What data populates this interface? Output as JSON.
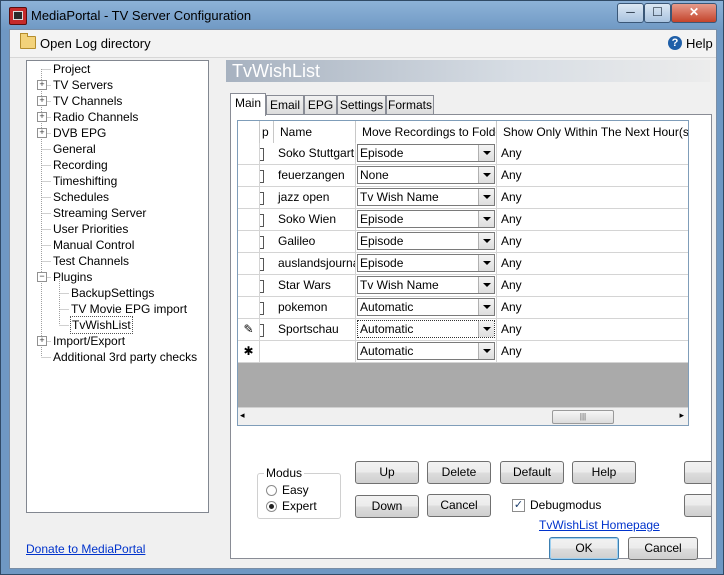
{
  "window": {
    "title": "MediaPortal - TV Server Configuration",
    "min": "─",
    "max": "☐",
    "close": "✕"
  },
  "toolbar": {
    "open_log": "Open Log directory",
    "help": "Help",
    "help_glyph": "?"
  },
  "tree": {
    "items": [
      {
        "label": "Project",
        "level": 0,
        "expand": ""
      },
      {
        "label": "TV Servers",
        "level": 0,
        "expand": "+"
      },
      {
        "label": "TV Channels",
        "level": 0,
        "expand": "+"
      },
      {
        "label": "Radio Channels",
        "level": 0,
        "expand": "+"
      },
      {
        "label": "DVB EPG",
        "level": 0,
        "expand": "+"
      },
      {
        "label": "General",
        "level": 0,
        "expand": ""
      },
      {
        "label": "Recording",
        "level": 0,
        "expand": ""
      },
      {
        "label": "Timeshifting",
        "level": 0,
        "expand": ""
      },
      {
        "label": "Schedules",
        "level": 0,
        "expand": ""
      },
      {
        "label": "Streaming Server",
        "level": 0,
        "expand": ""
      },
      {
        "label": "User Priorities",
        "level": 0,
        "expand": ""
      },
      {
        "label": "Manual Control",
        "level": 0,
        "expand": ""
      },
      {
        "label": "Test Channels",
        "level": 0,
        "expand": ""
      },
      {
        "label": "Plugins",
        "level": 0,
        "expand": "−"
      },
      {
        "label": "BackupSettings",
        "level": 1,
        "expand": ""
      },
      {
        "label": "TV Movie EPG import",
        "level": 1,
        "expand": ""
      },
      {
        "label": "TvWishList",
        "level": 1,
        "expand": "",
        "selected": true
      },
      {
        "label": "Import/Export",
        "level": 0,
        "expand": "+"
      },
      {
        "label": "Additional 3rd party checks",
        "level": 0,
        "expand": ""
      }
    ]
  },
  "section_title": "TvWishList",
  "tabs": [
    {
      "label": "Main",
      "active": true
    },
    {
      "label": "Email"
    },
    {
      "label": "EPG"
    },
    {
      "label": "Settings"
    },
    {
      "label": "Formats"
    }
  ],
  "grid": {
    "columns": [
      "p",
      "Name",
      "Move Recordings to Folder",
      "Show Only Within The Next Hour(s)"
    ],
    "rows": [
      {
        "marker": "",
        "name": "Soko Stuttgart",
        "folder": "Episode",
        "hours": "Any"
      },
      {
        "marker": "",
        "name": "feuerzangen",
        "folder": "None",
        "hours": "Any"
      },
      {
        "marker": "",
        "name": "jazz open",
        "folder": "Tv Wish Name",
        "hours": "Any"
      },
      {
        "marker": "",
        "name": "Soko Wien",
        "folder": "Episode",
        "hours": "Any"
      },
      {
        "marker": "",
        "name": "Galileo",
        "folder": "Episode",
        "hours": "Any"
      },
      {
        "marker": "",
        "name": "auslandsjournal",
        "folder": "Episode",
        "hours": "Any"
      },
      {
        "marker": "",
        "name": "Star Wars",
        "folder": "Tv Wish Name",
        "hours": "Any"
      },
      {
        "marker": "",
        "name": "pokemon",
        "folder": "Automatic",
        "hours": "Any"
      },
      {
        "marker": "✎",
        "name": "Sportschau",
        "folder": "Automatic",
        "hours": "Any",
        "editing": true
      },
      {
        "marker": "✱",
        "name": "",
        "folder": "Automatic",
        "hours": "Any",
        "new": true
      }
    ],
    "scroll_left": "◂",
    "scroll_right": "▸",
    "scroll_grip": "|||"
  },
  "modus": {
    "title": "Modus",
    "options": [
      "Easy",
      "Expert"
    ],
    "selected": "Expert"
  },
  "buttons": {
    "up": "Up",
    "delete": "Delete",
    "default": "Default",
    "help": "Help",
    "down": "Down",
    "cancel": "Cancel"
  },
  "debug": {
    "label": "Debugmodus",
    "checked": true,
    "check_glyph": "✓"
  },
  "homepage_link": "TvWishList Homepage",
  "footer": {
    "donate": "Donate to MediaPortal",
    "ok": "OK",
    "cancel": "Cancel"
  }
}
